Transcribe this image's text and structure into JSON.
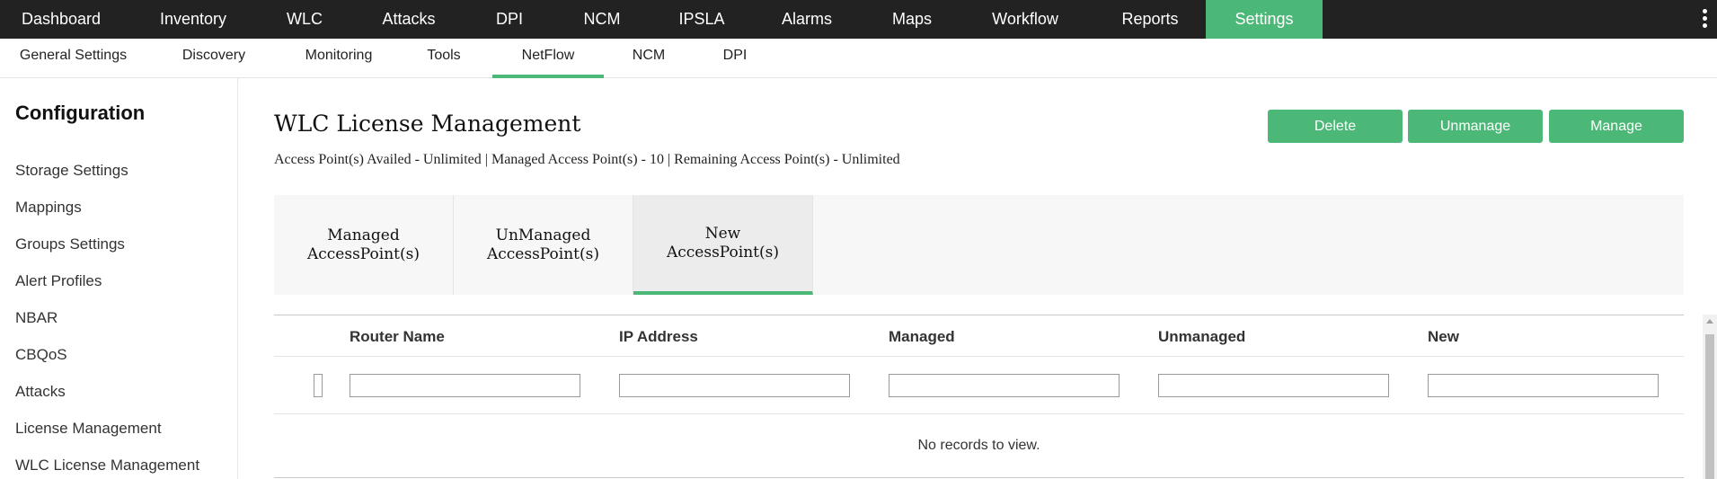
{
  "topnav": {
    "items": [
      "Dashboard",
      "Inventory",
      "WLC",
      "Attacks",
      "DPI",
      "NCM",
      "IPSLA",
      "Alarms",
      "Maps",
      "Workflow",
      "Reports",
      "Settings"
    ],
    "active": "Settings"
  },
  "subnav": {
    "items": [
      "General Settings",
      "Discovery",
      "Monitoring",
      "Tools",
      "NetFlow",
      "NCM",
      "DPI"
    ],
    "active": "NetFlow"
  },
  "sidebar": {
    "title": "Configuration",
    "items": [
      "Storage Settings",
      "Mappings",
      "Groups Settings",
      "Alert Profiles",
      "NBAR",
      "CBQoS",
      "Attacks",
      "License Management",
      "WLC License Management"
    ]
  },
  "main": {
    "title": "WLC License Management",
    "summary": "Access Point(s) Availed - Unlimited | Managed Access Point(s) - 10 | Remaining Access Point(s) - Unlimited",
    "buttons": {
      "delete": "Delete",
      "unmanage": "Unmanage",
      "manage": "Manage"
    },
    "tabs": [
      {
        "line1": "Managed",
        "line2": "AccessPoint(s)"
      },
      {
        "line1": "UnManaged",
        "line2": "AccessPoint(s)"
      },
      {
        "line1": "New",
        "line2": "AccessPoint(s)"
      }
    ],
    "active_tab": "New AccessPoint(s)",
    "grid": {
      "columns": [
        "Router Name",
        "IP Address",
        "Managed",
        "Unmanaged",
        "New"
      ],
      "filters": [
        "",
        "",
        "",
        "",
        ""
      ],
      "empty_message": "No records to view."
    }
  },
  "colors": {
    "accent": "#4cb877",
    "topnav_bg": "#222222"
  }
}
